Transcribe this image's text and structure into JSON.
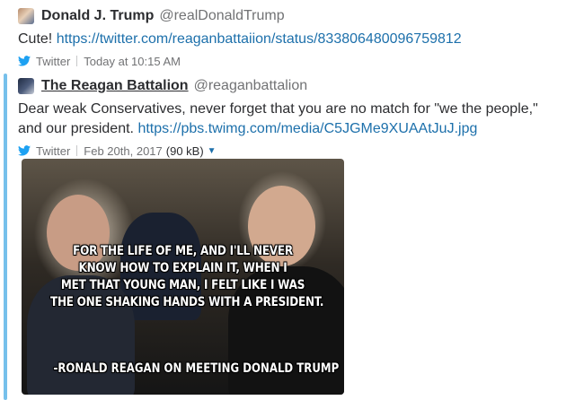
{
  "post1": {
    "author_name": "Donald J. Trump",
    "author_handle": "@realDonaldTrump",
    "text": "Cute!",
    "link": "https://twitter.com/reaganbattaiion/status/833806480096759812",
    "service": "Twitter",
    "timestamp": "Today at 10:15 AM"
  },
  "post2": {
    "author_name": "The Reagan Battalion",
    "author_handle": "@reaganbattalion",
    "text": "Dear weak Conservatives, never forget that you are no match for \"we the people,\" and our president.",
    "link": "https://pbs.twimg.com/media/C5JGMe9XUAAtJuJ.jpg",
    "service": "Twitter",
    "timestamp": "Feb 20th, 2017",
    "file_size": "(90 kB)",
    "image_caption_lines": [
      "FOR THE LIFE OF ME, AND I'LL NEVER",
      "KNOW HOW TO EXPLAIN IT, WHEN I",
      "MET THAT YOUNG MAN, I FELT LIKE I WAS",
      "THE ONE SHAKING HANDS WITH A PRESIDENT."
    ],
    "image_caption_attribution": "-RONALD REAGAN ON MEETING DONALD TRUMP"
  },
  "icons": {
    "twitter": "twitter-bird-icon",
    "caret": "caret-down-icon"
  },
  "colors": {
    "link": "#1d70ab",
    "rail": "#76c0eb",
    "twitter": "#1da1f2",
    "meta": "#717274"
  }
}
